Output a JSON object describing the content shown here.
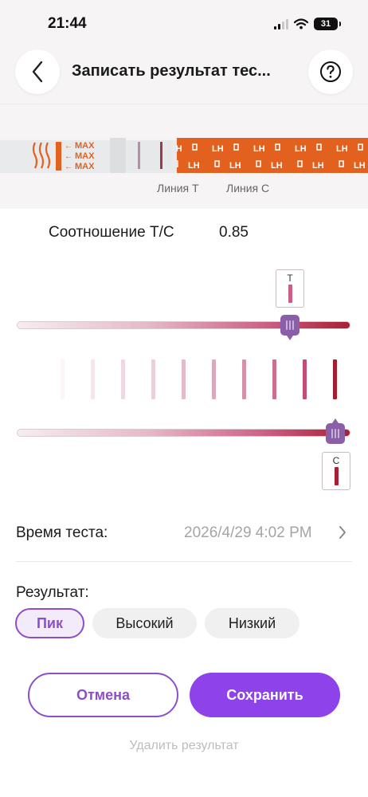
{
  "status_bar": {
    "time": "21:44",
    "battery": "31",
    "icons": [
      "signal-icon",
      "wifi-icon",
      "battery-icon"
    ]
  },
  "header": {
    "title": "Записать результат тес...",
    "back_icon": "chevron-left-icon",
    "help_icon": "question-circle-icon"
  },
  "strip": {
    "max_text": "MAX",
    "brand_text": "LH",
    "labels": {
      "line_t": "Линия T",
      "line_c": "Линия C"
    }
  },
  "ratio": {
    "label": "Соотношение Т/С",
    "value": "0.85"
  },
  "sliders": {
    "t": {
      "marker_label": "T",
      "position_fraction": 0.82
    },
    "c": {
      "marker_label": "C",
      "position_fraction": 0.955
    }
  },
  "scale_colors": [
    "#fbf5f7",
    "#f5e6ec",
    "#efd8e1",
    "#ead0da",
    "#e3bccb",
    "#dca9bc",
    "#d690aa",
    "#cd6f91",
    "#c24d72",
    "#a31f30"
  ],
  "test_time": {
    "label": "Время теста:",
    "value": "2026/4/29 4:02 PM"
  },
  "result": {
    "label": "Результат:",
    "options": [
      {
        "label": "Пик",
        "selected": true
      },
      {
        "label": "Высокий",
        "selected": false
      },
      {
        "label": "Низкий",
        "selected": false
      }
    ]
  },
  "actions": {
    "cancel": "Отмена",
    "save": "Сохранить",
    "delete": "Удалить результат"
  },
  "colors": {
    "accent": "#8c4fc9",
    "save_button": "#8d43e9",
    "strip_orange": "#e2611f",
    "thumb": "#8a5fa8"
  }
}
